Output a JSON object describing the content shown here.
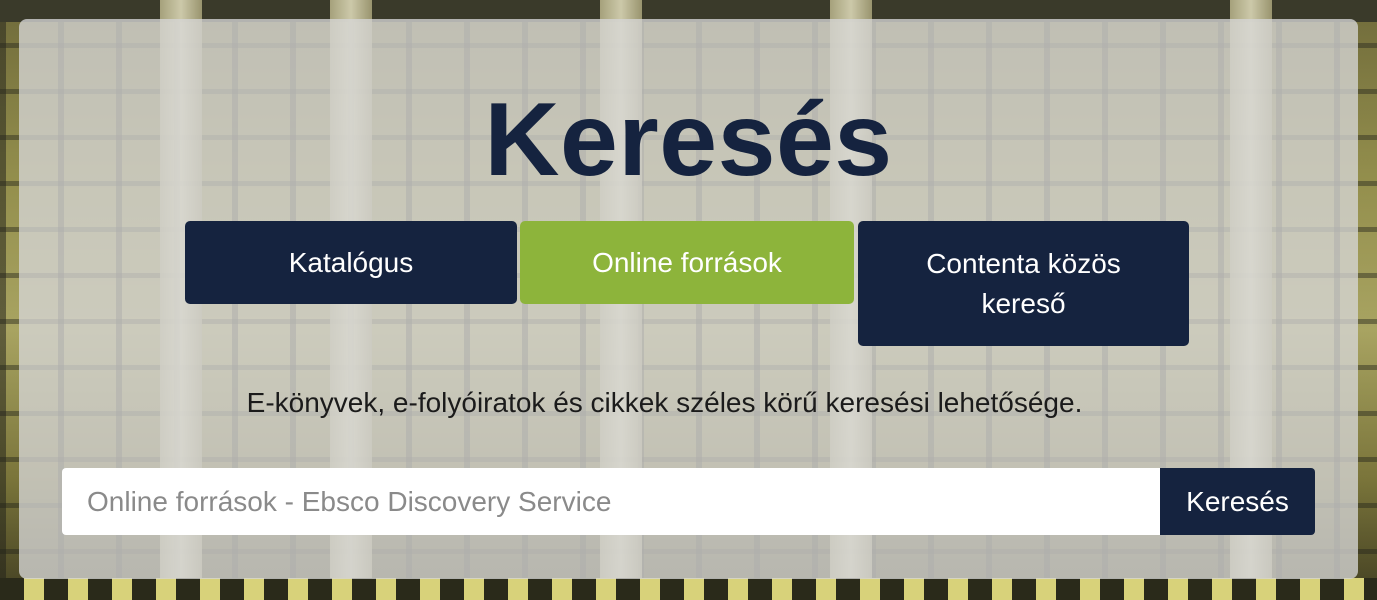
{
  "page": {
    "title": "Keresés"
  },
  "tabs": [
    {
      "label": "Katalógus",
      "active": false
    },
    {
      "label": "Online források",
      "active": true
    },
    {
      "label": "Contenta közös kereső",
      "active": false
    }
  ],
  "description": "E-könyvek, e-folyóiratok és cikkek széles körű keresési lehetősége.",
  "search": {
    "placeholder": "Online források - Ebsco Discovery Service",
    "value": "",
    "button_label": "Keresés"
  },
  "colors": {
    "navy": "#15233f",
    "active_green": "#8db43b",
    "panel": "#d6d6d6"
  }
}
